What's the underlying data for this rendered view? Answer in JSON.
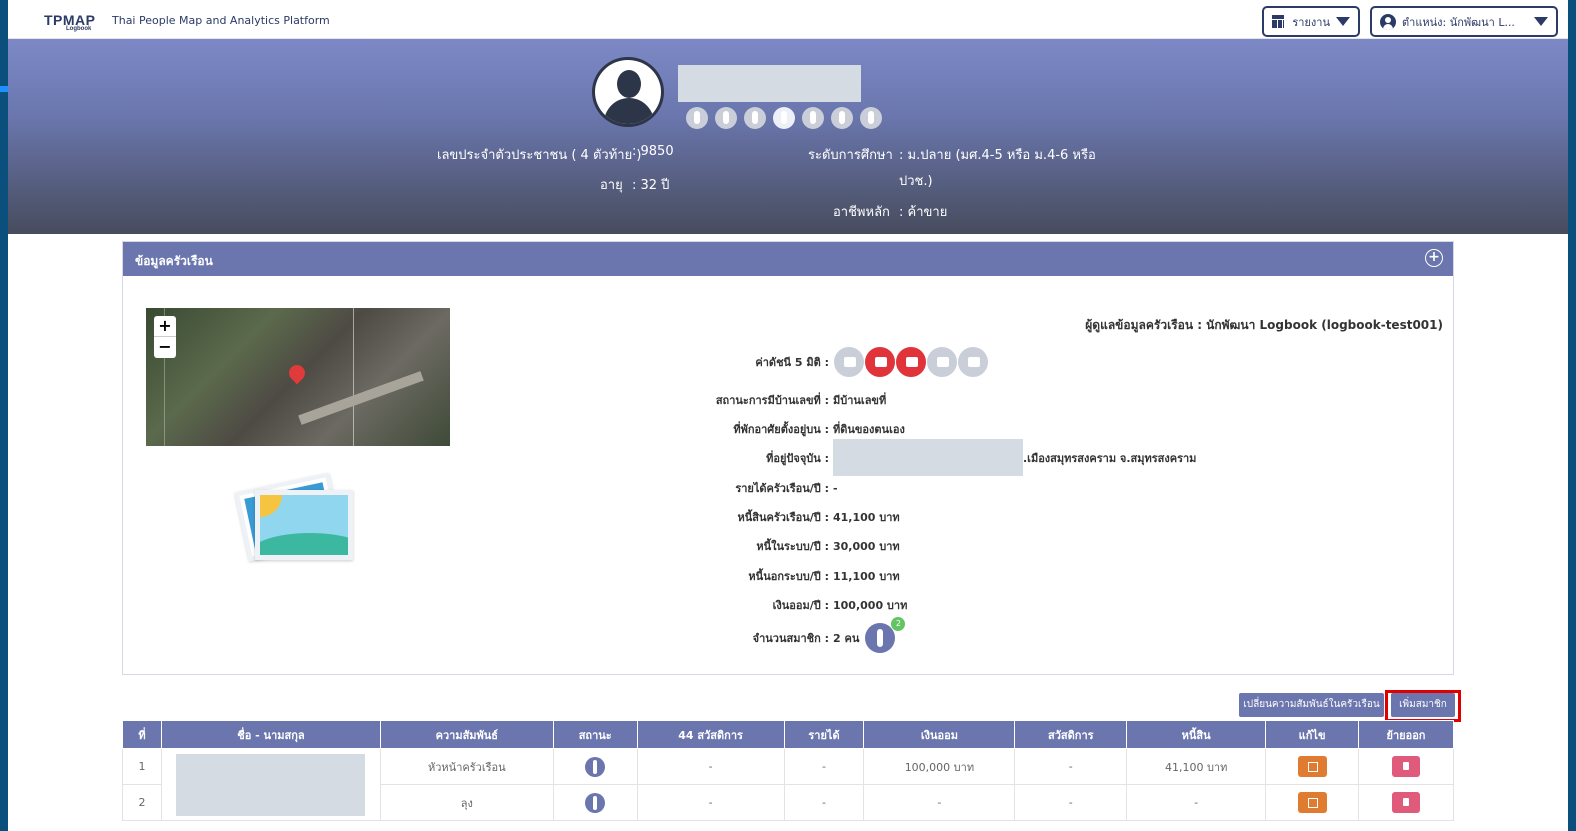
{
  "nav": {
    "logo": "TPMAP",
    "logo_sub": "Logbook",
    "platform_title": "Thai People Map and Analytics Platform",
    "report_label": "รายงาน",
    "user_label": "ตำแหน่ง: นักพัฒนา L..."
  },
  "profile": {
    "id_label": "เลขประจำตัวประชาชน ( 4 ตัวท้าย )",
    "id_value": ": 9850",
    "age_label": "อายุ",
    "age_value": ": 32 ปี",
    "education_label": "ระดับการศึกษา",
    "education_value_1": ":  ม.ปลาย (มศ.4-5 หรือ ม.4-6 หรือ",
    "education_value_2": "ปวช.)",
    "occupation_label": "อาชีพหลัก",
    "occupation_value": ":  ค้าขาย"
  },
  "household": {
    "title": "ข้อมูลครัวเรือน",
    "caretaker": "ผู้ดูแลข้อมูลครัวเรือน : นักพัฒนา Logbook (logbook-test001)",
    "map_zoom_in": "+",
    "map_zoom_out": "−",
    "index5_label": "ค่าดัชนี 5 มิติ :",
    "dimensions": [
      {
        "icon": "health-icon",
        "active": false
      },
      {
        "icon": "house-icon",
        "active": true
      },
      {
        "icon": "education-icon",
        "active": true
      },
      {
        "icon": "income-icon",
        "active": false
      },
      {
        "icon": "welfare-icon",
        "active": false
      }
    ],
    "house_no_label": "สถานะการมีบ้านเลขที่ :",
    "house_no_value": "มีบ้านเลขที่",
    "land_label": "ที่พักอาศัยตั้งอยู่บน :",
    "land_value": "ที่ดินของตนเอง",
    "address_label": "ที่อยู่ปัจจุบัน :",
    "address_value": ".เมืองสมุทรสงคราม จ.สมุทรสงคราม",
    "income_label": "รายได้ครัวเรือน/ปี :",
    "income_value": "-",
    "debt_label": "หนี้สินครัวเรือน/ปี :",
    "debt_value": "41,100 บาท",
    "debt_in_label": "หนี้ในระบบ/ปี :",
    "debt_in_value": "30,000 บาท",
    "debt_out_label": "หนี้นอกระบบ/ปี :",
    "debt_out_value": "11,100 บาท",
    "savings_label": "เงินออม/ปี :",
    "savings_value": "100,000 บาท",
    "members_label": "จำนวนสมาชิก :",
    "members_value": "2 คน",
    "members_badge": "2"
  },
  "actions": {
    "change_relation": "เปลี่ยนความสัมพันธ์ในครัวเรือน",
    "add_member": "เพิ่มสมาชิก"
  },
  "table": {
    "headers": [
      "ที่",
      "ชื่อ - นามสกุล",
      "ความสัมพันธ์",
      "สถานะ",
      "44 สวัสดิการ",
      "รายได้",
      "เงินออม",
      "สวัสดิการ",
      "หนี้สิน",
      "แก้ไข",
      "ย้ายออก"
    ],
    "rows": [
      {
        "no": "1",
        "relation": "หัวหน้าครัวเรือน",
        "welfare44": "-",
        "income": "-",
        "savings": "100,000 บาท",
        "welfare": "-",
        "debt": "41,100 บาท"
      },
      {
        "no": "2",
        "relation": "ลุง",
        "welfare44": "-",
        "income": "-",
        "savings": "-",
        "welfare": "-",
        "debt": "-"
      }
    ]
  }
}
